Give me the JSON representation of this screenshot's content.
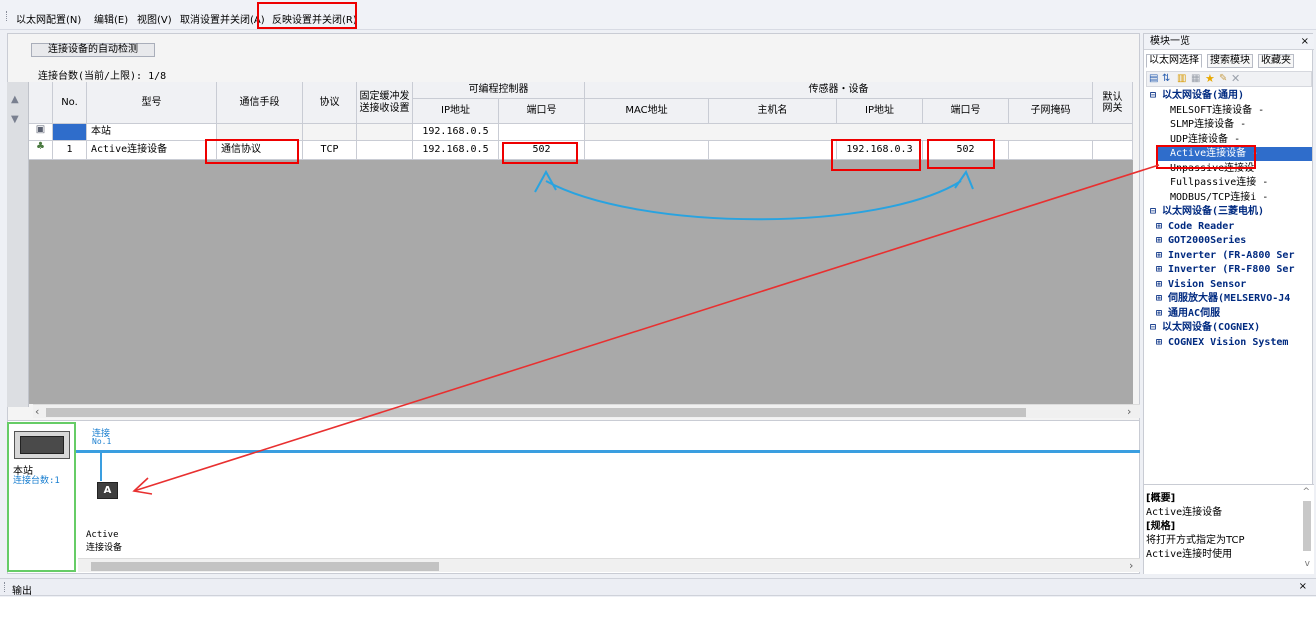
{
  "menu": {
    "items": [
      "以太网配置(N)",
      "编辑(E)",
      "视图(V)",
      "取消设置并关闭(A)",
      "反映设置并关闭(R)"
    ]
  },
  "main": {
    "autodetect_label": "连接设备的自动检测",
    "count_label": "连接台数(当前/上限): 1/8",
    "headers": {
      "no": "No.",
      "model": "型号",
      "comm": "通信手段",
      "protocol": "协议",
      "fixed_buffer": "固定缓冲发\n送接收设置",
      "plc_group": "可编程控制器",
      "plc_ip": "IP地址",
      "plc_port": "端口号",
      "sensor_group": "传感器・设备",
      "mac": "MAC地址",
      "host": "主机名",
      "dev_ip": "IP地址",
      "dev_port": "端口号",
      "subnet": "子网掩码",
      "gateway": "默认\n网关"
    },
    "rows": [
      {
        "no": "",
        "model": "本站",
        "comm": "",
        "protocol": "",
        "plc_ip": "192.168.0.5",
        "plc_port": "",
        "dev_ip": "",
        "dev_port": ""
      },
      {
        "no": "1",
        "model": "Active连接设备",
        "comm": "通信协议",
        "protocol": "TCP",
        "plc_ip": "192.168.0.5",
        "plc_port": "502",
        "dev_ip": "192.168.0.3",
        "dev_port": "502"
      }
    ]
  },
  "diagram": {
    "station_label": "本站",
    "station_count": "连接台数:1",
    "conn_label": "连接",
    "conn_no": "No.1",
    "device_line1": "Active",
    "device_line2": "连接设备"
  },
  "right_panel": {
    "title": "模块一览",
    "close": "×",
    "tabs": [
      "以太网选择",
      "搜索模块",
      "收藏夹"
    ],
    "tree": [
      {
        "label": "⊟ 以太网设备(通用)",
        "kind": "grp"
      },
      {
        "label": "MELSOFT连接设备 -",
        "kind": "item"
      },
      {
        "label": "SLMP连接设备    -",
        "kind": "item"
      },
      {
        "label": "UDP连接设备     -",
        "kind": "item"
      },
      {
        "label": "Active连接设备 -",
        "kind": "sel"
      },
      {
        "label": "Unpassive连接设",
        "kind": "item"
      },
      {
        "label": "Fullpassive连接 -",
        "kind": "item"
      },
      {
        "label": "MODBUS/TCP连接i -",
        "kind": "item"
      },
      {
        "label": "⊟ 以太网设备(三菱电机)",
        "kind": "grp"
      },
      {
        "label": "⊞ Code Reader",
        "kind": "sub"
      },
      {
        "label": "⊞ GOT2000Series",
        "kind": "sub"
      },
      {
        "label": "⊞ Inverter (FR-A800 Ser",
        "kind": "sub"
      },
      {
        "label": "⊞ Inverter (FR-F800 Ser",
        "kind": "sub"
      },
      {
        "label": "⊞ Vision Sensor",
        "kind": "sub"
      },
      {
        "label": "⊞ 伺服放大器(MELSERVO-J4",
        "kind": "sub"
      },
      {
        "label": "⊞ 通用AC伺服",
        "kind": "sub"
      },
      {
        "label": "⊟ 以太网设备(COGNEX)",
        "kind": "grp"
      },
      {
        "label": "⊞ COGNEX Vision System",
        "kind": "sub"
      }
    ],
    "desc": {
      "overview_title": "[概要]",
      "overview_text": "Active连接设备",
      "spec_title": "[规格]",
      "spec_line1": "将打开方式指定为TCP",
      "spec_line2": "Active连接时使用"
    }
  },
  "output": {
    "title": "输出",
    "close": "×"
  },
  "colors": {
    "highlight": "#ee0000",
    "arrow_blue": "#29a3e0",
    "bus_blue": "#3a9ee0",
    "selection": "#2f6dcb",
    "station_border": "#66cc66"
  }
}
